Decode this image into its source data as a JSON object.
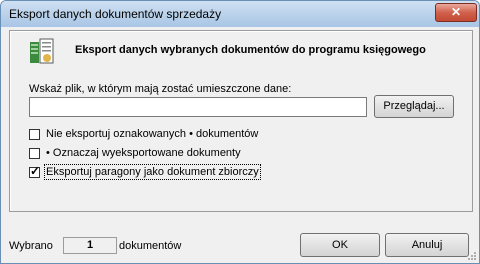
{
  "window": {
    "title": "Eksport danych dokumentów sprzedaży",
    "close_glyph": "✕"
  },
  "header": {
    "title": "Eksport danych wybranych dokumentów do programu księgowego",
    "icon": "export-docs-icon"
  },
  "file": {
    "prompt": "Wskaż plik, w którym mają zostać umieszczone dane:",
    "value": "",
    "browse_label": "Przeglądaj..."
  },
  "options": [
    {
      "label": "Nie eksportuj oznakowanych • dokumentów",
      "checked": false
    },
    {
      "label": "• Oznaczaj wyeksportowane dokumenty",
      "checked": false
    },
    {
      "label": "Eksportuj paragony jako dokument zbiorczy",
      "checked": true
    }
  ],
  "footer": {
    "selected_prefix": "Wybrano",
    "selected_count": "1",
    "selected_suffix": "dokumentów",
    "ok_label": "OK",
    "cancel_label": "Anuluj"
  }
}
